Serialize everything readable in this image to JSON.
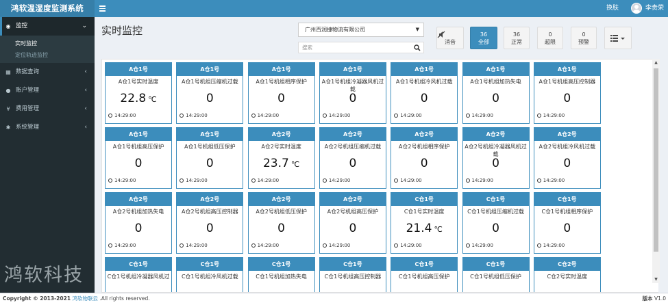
{
  "header": {
    "brand": "鸿软温湿度监测系统",
    "skin_label": "换肤",
    "username": "李贵荣"
  },
  "sidebar": {
    "items": [
      {
        "label": "监控",
        "icon": "dashboard-icon",
        "glyph": "◉",
        "chev": "⌄",
        "active": true,
        "children": [
          {
            "label": "实时监控",
            "current": true
          },
          {
            "label": "定位轨迹监控",
            "current": false
          }
        ]
      },
      {
        "label": "数据查询",
        "icon": "grid-icon",
        "glyph": "▦",
        "chev": "‹"
      },
      {
        "label": "账户管理",
        "icon": "user-icon",
        "glyph": "●",
        "chev": "‹"
      },
      {
        "label": "费用管理",
        "icon": "yen-icon",
        "glyph": "¥",
        "chev": "‹"
      },
      {
        "label": "系统管理",
        "icon": "gear-icon",
        "glyph": "✱",
        "chev": "‹"
      }
    ],
    "watermark": "鸿软科技"
  },
  "main": {
    "title": "实时监控",
    "company_select": "广州百润捷物流有限公司",
    "search_placeholder": "搜索",
    "controls": {
      "mute_label": "消音",
      "all": {
        "count": "36",
        "label": "全部"
      },
      "normal": {
        "count": "36",
        "label": "正常"
      },
      "over": {
        "count": "0",
        "label": "超限"
      },
      "warn": {
        "count": "0",
        "label": "预警"
      }
    },
    "cards": [
      {
        "title": "A仓1号",
        "name": "A仓1号实时温度",
        "value": "22.8",
        "unit": "℃",
        "time": "14:29:00"
      },
      {
        "title": "A仓1号",
        "name": "A仓1号机组压缩机过载",
        "value": "0",
        "unit": "",
        "time": "14:29:00"
      },
      {
        "title": "A仓1号",
        "name": "A仓1号机组相序保护",
        "value": "0",
        "unit": "",
        "time": "14:29:00"
      },
      {
        "title": "A仓1号",
        "name": "A仓1号机组冷凝器风机过载",
        "value": "0",
        "unit": "",
        "time": "14:29:00"
      },
      {
        "title": "A仓1号",
        "name": "A仓1号机组冷风机过载",
        "value": "0",
        "unit": "",
        "time": "14:29:00"
      },
      {
        "title": "A仓1号",
        "name": "A仓1号机组加热失电",
        "value": "0",
        "unit": "",
        "time": "14:29:00"
      },
      {
        "title": "A仓1号",
        "name": "A仓1号机组高压控制器",
        "value": "0",
        "unit": "",
        "time": "14:29:00"
      },
      {
        "title": "A仓1号",
        "name": "A仓1号机组高压保护",
        "value": "0",
        "unit": "",
        "time": "14:29:00"
      },
      {
        "title": "A仓1号",
        "name": "A仓1号机组低压保护",
        "value": "0",
        "unit": "",
        "time": "14:29:00"
      },
      {
        "title": "A仓2号",
        "name": "A仓2号实时温度",
        "value": "23.7",
        "unit": "℃",
        "time": "14:29:00"
      },
      {
        "title": "A仓2号",
        "name": "A仓2号机组压缩机过载",
        "value": "0",
        "unit": "",
        "time": "14:29:00"
      },
      {
        "title": "A仓2号",
        "name": "A仓2号机组相序保护",
        "value": "0",
        "unit": "",
        "time": "14:29:00"
      },
      {
        "title": "A仓2号",
        "name": "A仓2号机组冷凝器风机过载",
        "value": "0",
        "unit": "",
        "time": "14:29:00"
      },
      {
        "title": "A仓2号",
        "name": "A仓2号机组冷风机过载",
        "value": "0",
        "unit": "",
        "time": "14:29:00"
      },
      {
        "title": "A仓2号",
        "name": "A仓2号机组加热失电",
        "value": "0",
        "unit": "",
        "time": "14:29:00"
      },
      {
        "title": "A仓2号",
        "name": "A仓2号机组高压控制器",
        "value": "0",
        "unit": "",
        "time": "14:29:00"
      },
      {
        "title": "A仓2号",
        "name": "A仓2号机组低压保护",
        "value": "0",
        "unit": "",
        "time": "14:29:00"
      },
      {
        "title": "A仓2号",
        "name": "A仓2号机组高压保护",
        "value": "0",
        "unit": "",
        "time": "14:29:00"
      },
      {
        "title": "C仓1号",
        "name": "C仓1号实时温度",
        "value": "21.4",
        "unit": "℃",
        "time": "14:29:00"
      },
      {
        "title": "C仓1号",
        "name": "C仓1号机组压缩机过载",
        "value": "0",
        "unit": "",
        "time": "14:29:00"
      },
      {
        "title": "C仓1号",
        "name": "C仓1号机组相序保护",
        "value": "0",
        "unit": "",
        "time": "14:29:00"
      },
      {
        "title": "C仓1号",
        "name": "C仓1号机组冷凝器风机过",
        "value": "",
        "unit": "",
        "time": ""
      },
      {
        "title": "C仓1号",
        "name": "C仓1号机组冷风机过载",
        "value": "",
        "unit": "",
        "time": ""
      },
      {
        "title": "C仓1号",
        "name": "C仓1号机组加热失电",
        "value": "",
        "unit": "",
        "time": ""
      },
      {
        "title": "C仓1号",
        "name": "C仓1号机组高压控制器",
        "value": "",
        "unit": "",
        "time": ""
      },
      {
        "title": "C仓1号",
        "name": "C仓1号机组高压保护",
        "value": "",
        "unit": "",
        "time": ""
      },
      {
        "title": "C仓1号",
        "name": "C仓1号机组低压保护",
        "value": "",
        "unit": "",
        "time": ""
      },
      {
        "title": "C仓2号",
        "name": "C仓2号实时温度",
        "value": "",
        "unit": "",
        "time": ""
      }
    ]
  },
  "footer": {
    "copyright": "Copyright © 2013-2021",
    "link": "鸿软物联云",
    "rights": ".All rights reserved.",
    "version_label": "版本",
    "version": "V1.0"
  }
}
